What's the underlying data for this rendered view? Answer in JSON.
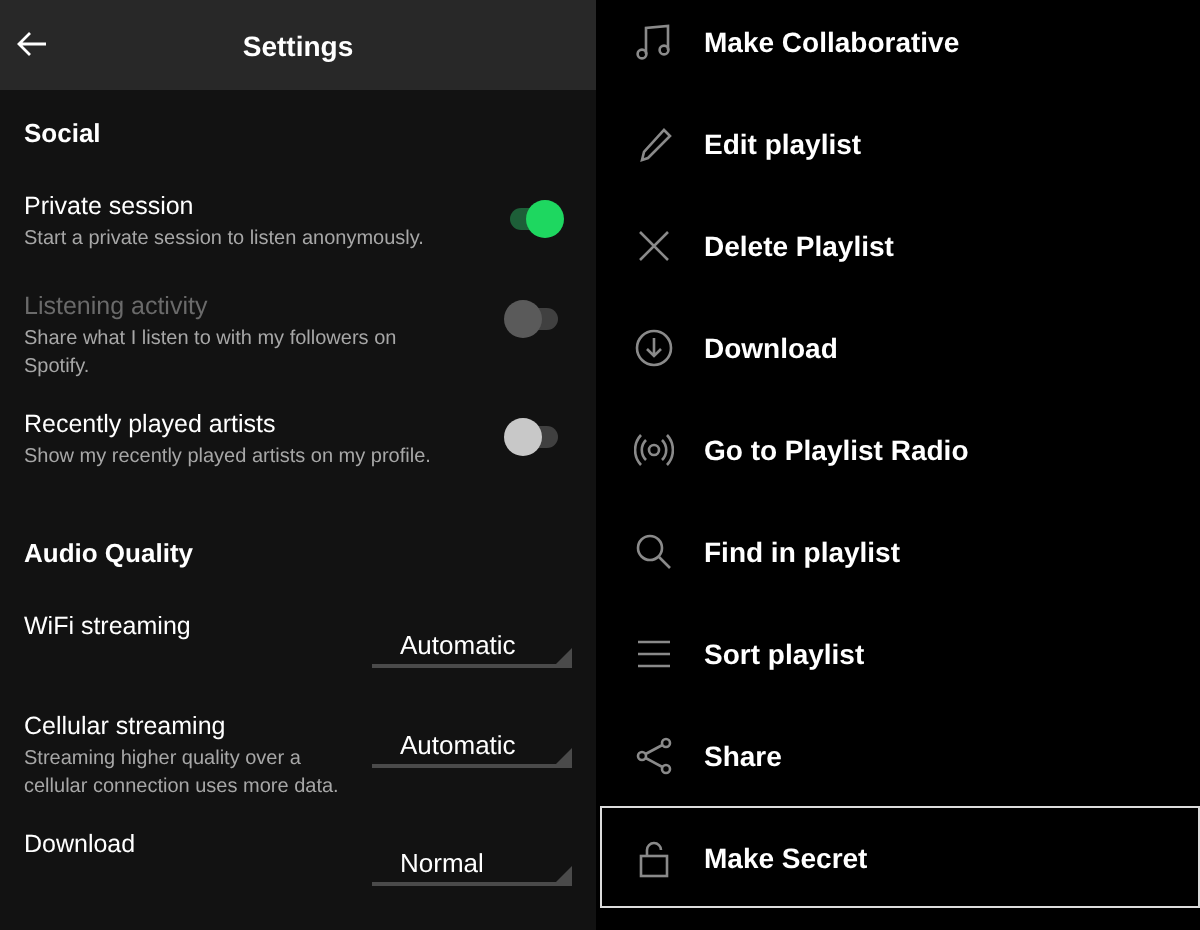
{
  "settings": {
    "title": "Settings",
    "sections": [
      {
        "title": "Social",
        "rows": [
          {
            "kind": "toggle",
            "title": "Private session",
            "description": "Start a private session to listen anonymously.",
            "on": true,
            "disabled": false
          },
          {
            "kind": "toggle",
            "title": "Listening activity",
            "description": "Share what I listen to with my followers on Spotify.",
            "on": false,
            "disabled": true
          },
          {
            "kind": "toggle",
            "title": "Recently played artists",
            "description": "Show my recently played artists on my profile.",
            "on": false,
            "disabled": false
          }
        ]
      },
      {
        "title": "Audio Quality",
        "rows": [
          {
            "kind": "dropdown",
            "title": "WiFi streaming",
            "value": "Automatic"
          },
          {
            "kind": "dropdown",
            "title": "Cellular streaming",
            "description": "Streaming higher quality over a cellular connection uses more data.",
            "value": "Automatic"
          },
          {
            "kind": "dropdown",
            "title": "Download",
            "value": "Normal"
          }
        ]
      }
    ]
  },
  "menu": {
    "items": [
      {
        "label": "Make Collaborative",
        "selected": false
      },
      {
        "label": "Edit playlist",
        "selected": false
      },
      {
        "label": "Delete Playlist",
        "selected": false
      },
      {
        "label": "Download",
        "selected": false
      },
      {
        "label": "Go to Playlist Radio",
        "selected": false
      },
      {
        "label": "Find in playlist",
        "selected": false
      },
      {
        "label": "Sort playlist",
        "selected": false
      },
      {
        "label": "Share",
        "selected": false
      },
      {
        "label": "Make Secret",
        "selected": true
      }
    ]
  }
}
